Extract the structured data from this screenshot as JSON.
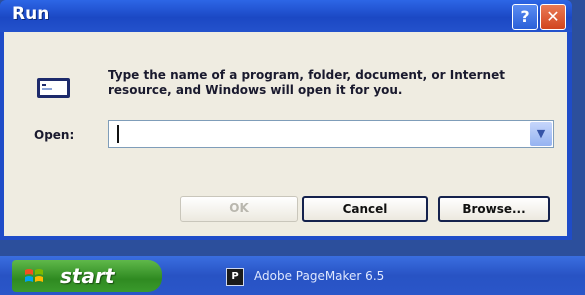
{
  "window": {
    "title": "Run",
    "help_glyph": "?",
    "close_glyph": "✕"
  },
  "dialog": {
    "description": "Type the name of a program, folder, document, or Internet resource, and Windows will open it for you.",
    "open_label": "Open:",
    "open_value": "",
    "dropdown_glyph": "▼"
  },
  "buttons": {
    "ok": "OK",
    "cancel": "Cancel",
    "browse": "Browse..."
  },
  "taskbar": {
    "start_label": "start",
    "task_label": "Adobe PageMaker 6.5",
    "task_icon_glyph": "P"
  },
  "icons": {
    "run": "run-icon",
    "start_flag": "windows-flag-icon",
    "task": "pagemaker-icon"
  },
  "colors": {
    "title_bar": "#1f4cc8",
    "dialog_bg": "#efece1",
    "close_button": "#d2451e",
    "start_button": "#2f8a21",
    "taskbar": "#2853c4"
  }
}
